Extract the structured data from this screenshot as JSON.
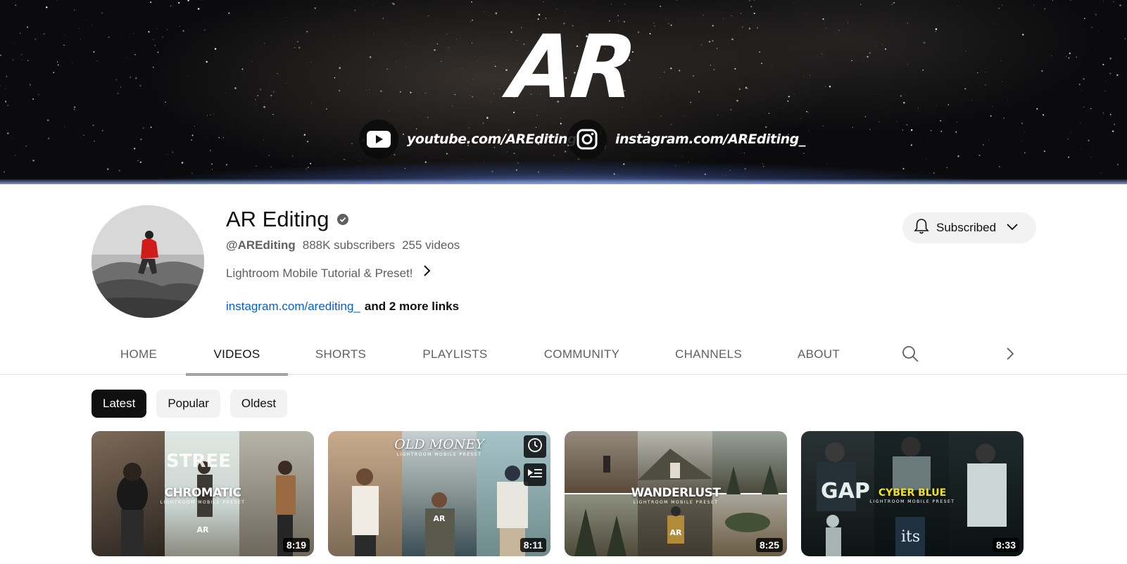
{
  "banner": {
    "logo_text": "AR",
    "links": [
      {
        "icon": "youtube-icon",
        "text": "youtube.com/AREditing"
      },
      {
        "icon": "instagram-icon",
        "text": "instagram.com/AREditing_"
      }
    ]
  },
  "channel": {
    "name": "AR Editing",
    "verified_icon": "verified-check-icon",
    "handle": "@AREditing",
    "subscribers": "888K subscribers",
    "videos": "255 videos",
    "description": "Lightroom Mobile Tutorial & Preset!",
    "link": "instagram.com/arediting_",
    "more_links": "and 2 more links"
  },
  "subscribe": {
    "label": "Subscribed",
    "icon": "bell-icon"
  },
  "tabs": [
    {
      "label": "HOME",
      "active": false
    },
    {
      "label": "VIDEOS",
      "active": true
    },
    {
      "label": "SHORTS",
      "active": false
    },
    {
      "label": "PLAYLISTS",
      "active": false
    },
    {
      "label": "COMMUNITY",
      "active": false
    },
    {
      "label": "CHANNELS",
      "active": false
    },
    {
      "label": "ABOUT",
      "active": false
    }
  ],
  "filters": [
    {
      "label": "Latest",
      "active": true
    },
    {
      "label": "Popular",
      "active": false
    },
    {
      "label": "Oldest",
      "active": false
    }
  ],
  "videos": [
    {
      "title_art": "CHROMATIC",
      "sub_art": "LIGHTROOM MOBILE PRESET",
      "duration": "8:19",
      "street_text": "STREE"
    },
    {
      "title_art": "OLD MONEY",
      "sub_art": "LIGHTROOM MOBILE PRESET",
      "duration": "8:11"
    },
    {
      "title_art": "WANDERLUST",
      "sub_art": "LIGHTROOM MOBILE PRESET",
      "duration": "8:25"
    },
    {
      "title_art": "CYBER BLUE",
      "sub_art": "LIGHTROOM MOBILE PRESET",
      "duration": "8:33",
      "shirt_text": "its"
    }
  ],
  "thumbnail_mark": "AR",
  "colors": {
    "link": "#065fd4",
    "chip_active_bg": "#0f0f0f",
    "chip_bg": "#f2f2f2",
    "cyber_blue_title": "#f2e21c"
  }
}
